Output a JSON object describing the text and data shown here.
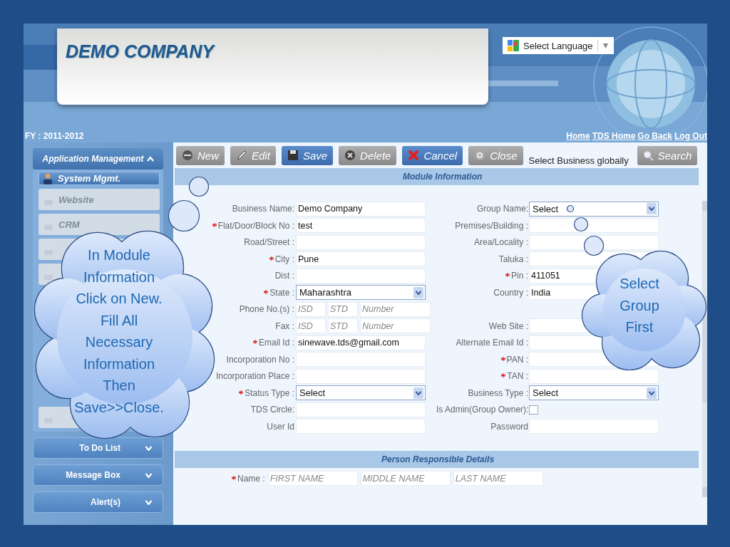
{
  "header": {
    "company": "DEMO COMPANY",
    "language": {
      "label": "Select Language"
    },
    "fiscal_year": "FY : 2011-2012",
    "links": [
      "Home",
      "TDS Home",
      "Go Back",
      "Log Out"
    ]
  },
  "sidebar": {
    "title": "Application Management",
    "expanded": true,
    "items": [
      {
        "label": "System Mgmt.",
        "selected": true,
        "disabled": false
      },
      {
        "label": "Website",
        "selected": false,
        "disabled": true
      },
      {
        "label": "CRM",
        "selected": false,
        "disabled": true
      },
      {
        "selected": false,
        "disabled": true
      },
      {
        "selected": false,
        "disabled": true
      },
      {
        "selected": false,
        "disabled": true
      }
    ],
    "panels": [
      {
        "label": "To Do List",
        "expanded": false
      },
      {
        "label": "Message Box",
        "expanded": false
      },
      {
        "label": "Alert(s)",
        "expanded": false
      }
    ]
  },
  "toolbar": {
    "buttons": [
      {
        "label": "New",
        "kind": "new",
        "disabled": true
      },
      {
        "label": "Edit",
        "kind": "edit",
        "disabled": true
      },
      {
        "label": "Save",
        "kind": "save",
        "disabled": false
      },
      {
        "label": "Delete",
        "kind": "delete",
        "disabled": true
      },
      {
        "label": "Cancel",
        "kind": "cancel",
        "disabled": false
      },
      {
        "label": "Close",
        "kind": "close",
        "disabled": true
      }
    ],
    "global_text": "Select Business globally",
    "search": {
      "label": "Search"
    }
  },
  "module_section": {
    "title": "Module Information",
    "left_fields": [
      {
        "label": "Business Name:",
        "required": false,
        "kind": "text",
        "value": "Demo Company"
      },
      {
        "label": "Flat/Door/Block No :",
        "required": true,
        "kind": "text",
        "value": "test"
      },
      {
        "label": "Road/Street :",
        "required": false,
        "kind": "text"
      },
      {
        "label": "City :",
        "required": true,
        "kind": "text",
        "value": "Pune"
      },
      {
        "label": "Dist :",
        "required": false,
        "kind": "text"
      },
      {
        "label": "State :",
        "required": true,
        "kind": "select",
        "value": "Maharashtra"
      },
      {
        "label": "Phone No.(s) :",
        "required": false,
        "kind": "phone",
        "placeholders": [
          "ISD",
          "STD",
          "Number"
        ]
      },
      {
        "label": "Fax :",
        "required": false,
        "kind": "phone",
        "placeholders": [
          "ISD",
          "STD",
          "Number"
        ]
      },
      {
        "label": "Email Id :",
        "required": true,
        "kind": "text",
        "value": "sinewave.tds@gmail.com"
      },
      {
        "label": "Incorporation No :",
        "required": false,
        "kind": "text"
      },
      {
        "label": "Incorporation Place :",
        "required": false,
        "kind": "text"
      },
      {
        "label": "Status Type :",
        "required": true,
        "kind": "select",
        "value": "Select"
      },
      {
        "label": "TDS Circle:",
        "required": false,
        "kind": "text"
      },
      {
        "label": "User Id",
        "required": false,
        "kind": "text"
      }
    ],
    "right_fields": [
      {
        "label": "Group Name:",
        "required": false,
        "kind": "select",
        "value": "Select"
      },
      {
        "label": "Premises/Building :",
        "required": false,
        "kind": "text"
      },
      {
        "label": "Area/Locality :",
        "required": false,
        "kind": "text"
      },
      {
        "label": "Taluka :",
        "required": false,
        "kind": "text"
      },
      {
        "label": "Pin :",
        "required": true,
        "kind": "text",
        "value": "411051"
      },
      {
        "label": "Country :",
        "required": false,
        "kind": "text",
        "value": "India"
      },
      {
        "kind": "blank"
      },
      {
        "label": "Web Site :",
        "required": false,
        "kind": "text"
      },
      {
        "label": "Alternate Email Id :",
        "required": false,
        "kind": "text"
      },
      {
        "label": "PAN :",
        "required": true,
        "kind": "text"
      },
      {
        "label": "TAN :",
        "required": true,
        "kind": "text"
      },
      {
        "label": "Business Type :",
        "required": false,
        "kind": "select",
        "value": "Select"
      },
      {
        "label": "Is Admin(Group Owner):",
        "required": false,
        "kind": "checkbox",
        "checked": false
      },
      {
        "label": "Password",
        "required": false,
        "kind": "text"
      }
    ]
  },
  "person_section": {
    "title": "Person Responsible Details",
    "name_label": "Name :",
    "name_required": true,
    "placeholders": [
      "FIRST NAME",
      "MIDDLE NAME",
      "LAST NAME"
    ]
  },
  "callouts": [
    {
      "text": "In Module Information Click on New. Fill All Necessary Information Then Save>>Close.",
      "kind": "left"
    },
    {
      "text": "Select Group First",
      "kind": "right"
    }
  ]
}
